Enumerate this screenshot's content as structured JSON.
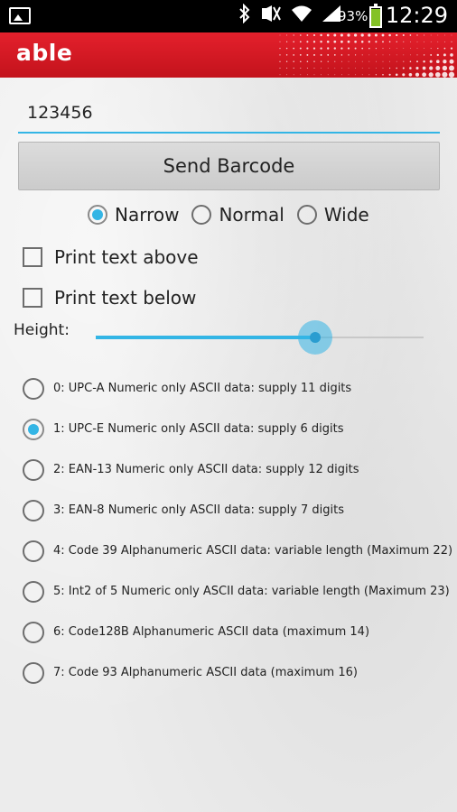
{
  "status_bar": {
    "icons": [
      "photo-icon",
      "bluetooth-icon",
      "mute-icon",
      "wifi-icon",
      "signal-icon"
    ],
    "battery_percent": "93%",
    "battery_level": 0.93,
    "time": "12:29"
  },
  "app": {
    "logo": "able",
    "brand_color": "#d71920"
  },
  "form": {
    "barcode_value": "123456",
    "send_label": "Send Barcode",
    "width_options": [
      {
        "label": "Narrow",
        "selected": true
      },
      {
        "label": "Normal",
        "selected": false
      },
      {
        "label": "Wide",
        "selected": false
      }
    ],
    "print_text_above": {
      "label": "Print text above",
      "checked": false
    },
    "print_text_below": {
      "label": "Print text below",
      "checked": false
    },
    "height_label": "Height:",
    "height_value": 0.67,
    "accent_color": "#33b5e5"
  },
  "barcode_types": [
    {
      "label": "0: UPC-A Numeric only ASCII data: supply 11 digits",
      "selected": false
    },
    {
      "label": "1: UPC-E Numeric only ASCII data: supply  6 digits",
      "selected": true
    },
    {
      "label": "2: EAN-13 Numeric only ASCII data: supply 12 digits",
      "selected": false
    },
    {
      "label": "3: EAN-8 Numeric only ASCII data: supply  7 digits",
      "selected": false
    },
    {
      "label": "4: Code 39 Alphanumeric ASCII data: variable length (Maximum 22)",
      "selected": false
    },
    {
      "label": "5: Int2 of 5 Numeric only ASCII data:  variable length (Maximum 23)",
      "selected": false
    },
    {
      "label": "6: Code128B Alphanumeric ASCII data (maximum 14)",
      "selected": false
    },
    {
      "label": "7: Code 93 Alphanumeric ASCII data (maximum 16)",
      "selected": false
    }
  ]
}
